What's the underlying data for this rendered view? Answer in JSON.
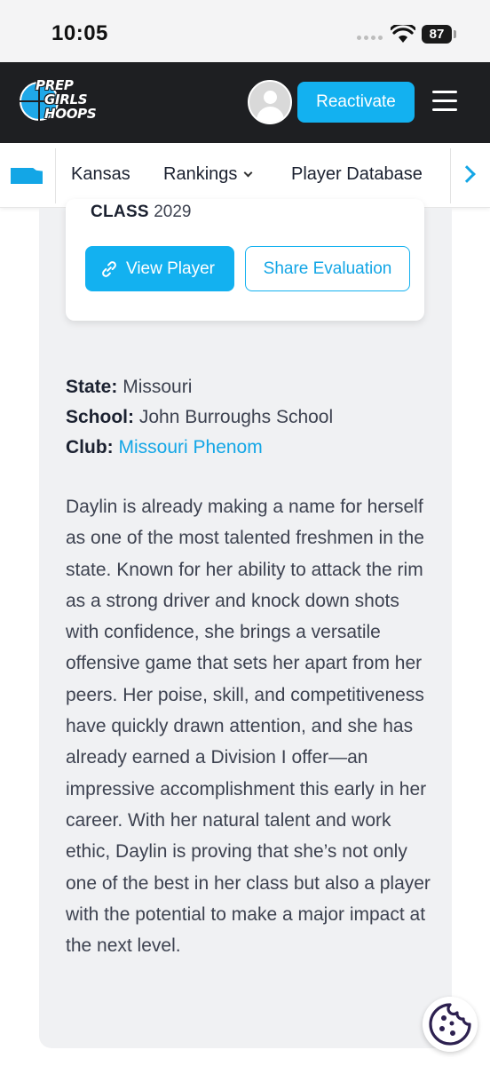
{
  "status_bar": {
    "time": "10:05",
    "battery": "87"
  },
  "header": {
    "logo_lines": [
      "PREP",
      "GIRLS",
      "HOOPS"
    ],
    "reactivate_label": "Reactivate"
  },
  "nav": {
    "items": [
      {
        "label": "Kansas"
      },
      {
        "label": "Rankings"
      },
      {
        "label": "Player Database"
      }
    ]
  },
  "player_card": {
    "class_label": "CLASS",
    "class_year": "2029",
    "view_player_label": "View Player",
    "share_label": "Share Evaluation"
  },
  "info": {
    "state_label": "State:",
    "state_value": "Missouri",
    "school_label": "School:",
    "school_value": "John Burroughs School",
    "club_label": "Club:",
    "club_value": "Missouri Phenom"
  },
  "bio": "Daylin is already making a name for herself as one of the most talented freshmen in the state. Known for her ability to attack the rim as a strong driver and knock down shots with confidence, she brings a versatile offensive game that sets her apart from her peers. Her poise, skill, and competitiveness have quickly drawn attention, and she has already earned a Division I offer—an impressive accomplishment this early in her career. With her natural talent and work ethic, Daylin is proving that she’s not only one of the best in her class but also a player with the potential to make a major impact at the next level.",
  "colors": {
    "accent": "#13b1f0",
    "header_bg": "#1e1f22",
    "panel_bg": "#f0f1f3",
    "cookie": "#2d2150"
  }
}
